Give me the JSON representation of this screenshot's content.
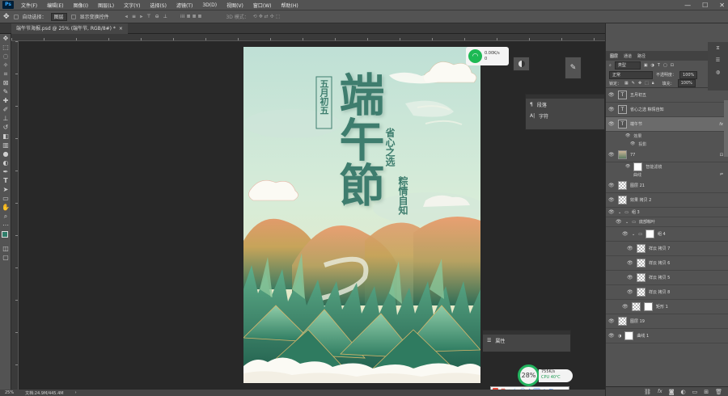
{
  "menubar": {
    "app_icon": "Ps",
    "items": [
      "文件(F)",
      "编辑(E)",
      "图像(I)",
      "图层(L)",
      "文字(Y)",
      "选择(S)",
      "滤镜(T)",
      "3D(D)",
      "视图(V)",
      "窗口(W)",
      "帮助(H)"
    ],
    "minimize": "—",
    "maximize": "☐",
    "close": "✕"
  },
  "options": {
    "auto_select_label": "自动选择：",
    "auto_select_value": "图层",
    "show_transform_label": "显示变换控件",
    "mode_3d": "3D 模式："
  },
  "document_tab": {
    "title": "端午节海报.psd @ 25% (端午节, RGB/8#) *",
    "close": "×"
  },
  "statusbar": {
    "zoom": "25%",
    "doc": "文档:24.9M/445.4M",
    "arrow": "›"
  },
  "poster": {
    "title": "端午節",
    "date": "五月初五",
    "line1": "省心之选",
    "line2": "粽情自知"
  },
  "floating": {
    "paragraph": "段落",
    "character": "字符",
    "properties": "属性"
  },
  "net_widget": {
    "up": "0.00K/s",
    "down": "0"
  },
  "cpu_widget": {
    "percent": "28%",
    "speed": "755K/s",
    "temp": "CPU 40℃"
  },
  "layers_panel": {
    "tabs": [
      "图层",
      "通道",
      "路径"
    ],
    "filter_kind": "类型",
    "blend_mode": "正常",
    "opacity_label": "不透明度：",
    "opacity": "100%",
    "lock_label": "锁定：",
    "fill_label": "填充：",
    "fill": "100%",
    "rows": [
      {
        "name": "五月初五",
        "kind": "text"
      },
      {
        "name": "省心之选  粽情自知",
        "kind": "text"
      },
      {
        "name": "端午节",
        "kind": "text",
        "selected": true,
        "fx": "fx"
      },
      {
        "name": "效果",
        "kind": "sub"
      },
      {
        "name": "投影",
        "kind": "sub"
      },
      {
        "name": "77",
        "kind": "photo"
      },
      {
        "name": "智能滤镜",
        "kind": "sub"
      },
      {
        "name": "曲线",
        "kind": "sub"
      },
      {
        "name": "图层 21",
        "kind": "pixel"
      },
      {
        "name": "效果 拷贝 2",
        "kind": "pixel"
      },
      {
        "name": "组 3",
        "kind": "group"
      },
      {
        "name": "底部粽叶",
        "kind": "group"
      },
      {
        "name": "组 4",
        "kind": "group"
      },
      {
        "name": "祥云 拷贝 7",
        "kind": "pixel"
      },
      {
        "name": "祥云 拷贝 6",
        "kind": "pixel"
      },
      {
        "name": "祥云 拷贝 5",
        "kind": "pixel"
      },
      {
        "name": "祥云 拷贝 8",
        "kind": "pixel"
      },
      {
        "name": "矩形 1",
        "kind": "pixel"
      },
      {
        "name": "图层 19",
        "kind": "pixel"
      },
      {
        "name": "曲线 1",
        "kind": "pixel"
      }
    ],
    "bottom_icons": [
      "链接",
      "fx",
      "蒙版",
      "调整",
      "组",
      "新建",
      "删除"
    ]
  },
  "ime_bar": {
    "label": "英"
  },
  "colors": {
    "accent": "#31a8ff",
    "poster_green": "#2f7d6a",
    "poster_text": "#3e7d6e"
  }
}
